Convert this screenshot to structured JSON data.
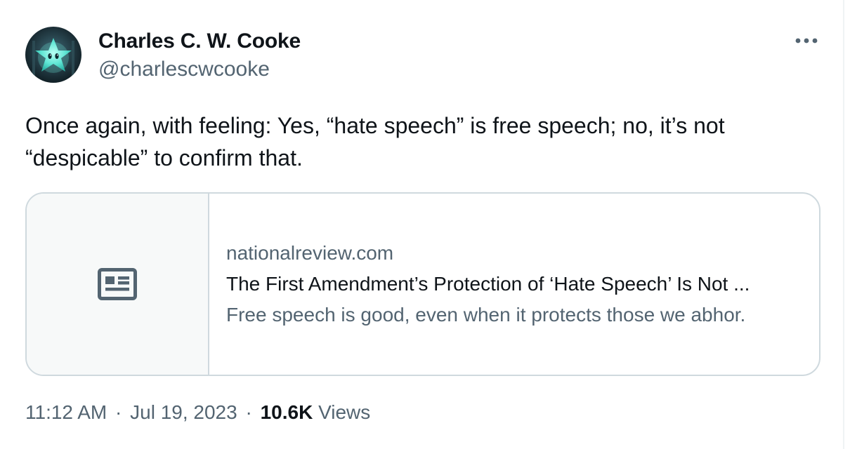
{
  "author": {
    "name": "Charles C. W. Cooke",
    "handle": "@charlescwcooke",
    "avatar_icon": "avatar-star-character"
  },
  "more_icon": "more-horizontal-icon",
  "tweet": {
    "text": "Once again, with feeling: Yes, “hate speech” is free speech; no, it’s not “despicable” to confirm that."
  },
  "card": {
    "thumb_icon": "news-article-icon",
    "domain": "nationalreview.com",
    "title": "The First Amendment’s Protection of ‘Hate Speech’ Is Not ...",
    "description": "Free speech is good, even when it protects those we abhor."
  },
  "meta": {
    "time": "11:12 AM",
    "date": "Jul 19, 2023",
    "separator": "·",
    "views_count": "10.6K",
    "views_label": "Views"
  },
  "colors": {
    "text_primary": "#0f1419",
    "text_secondary": "#536471",
    "border": "#cfd9de",
    "card_thumb_bg": "#f7f9f9"
  }
}
